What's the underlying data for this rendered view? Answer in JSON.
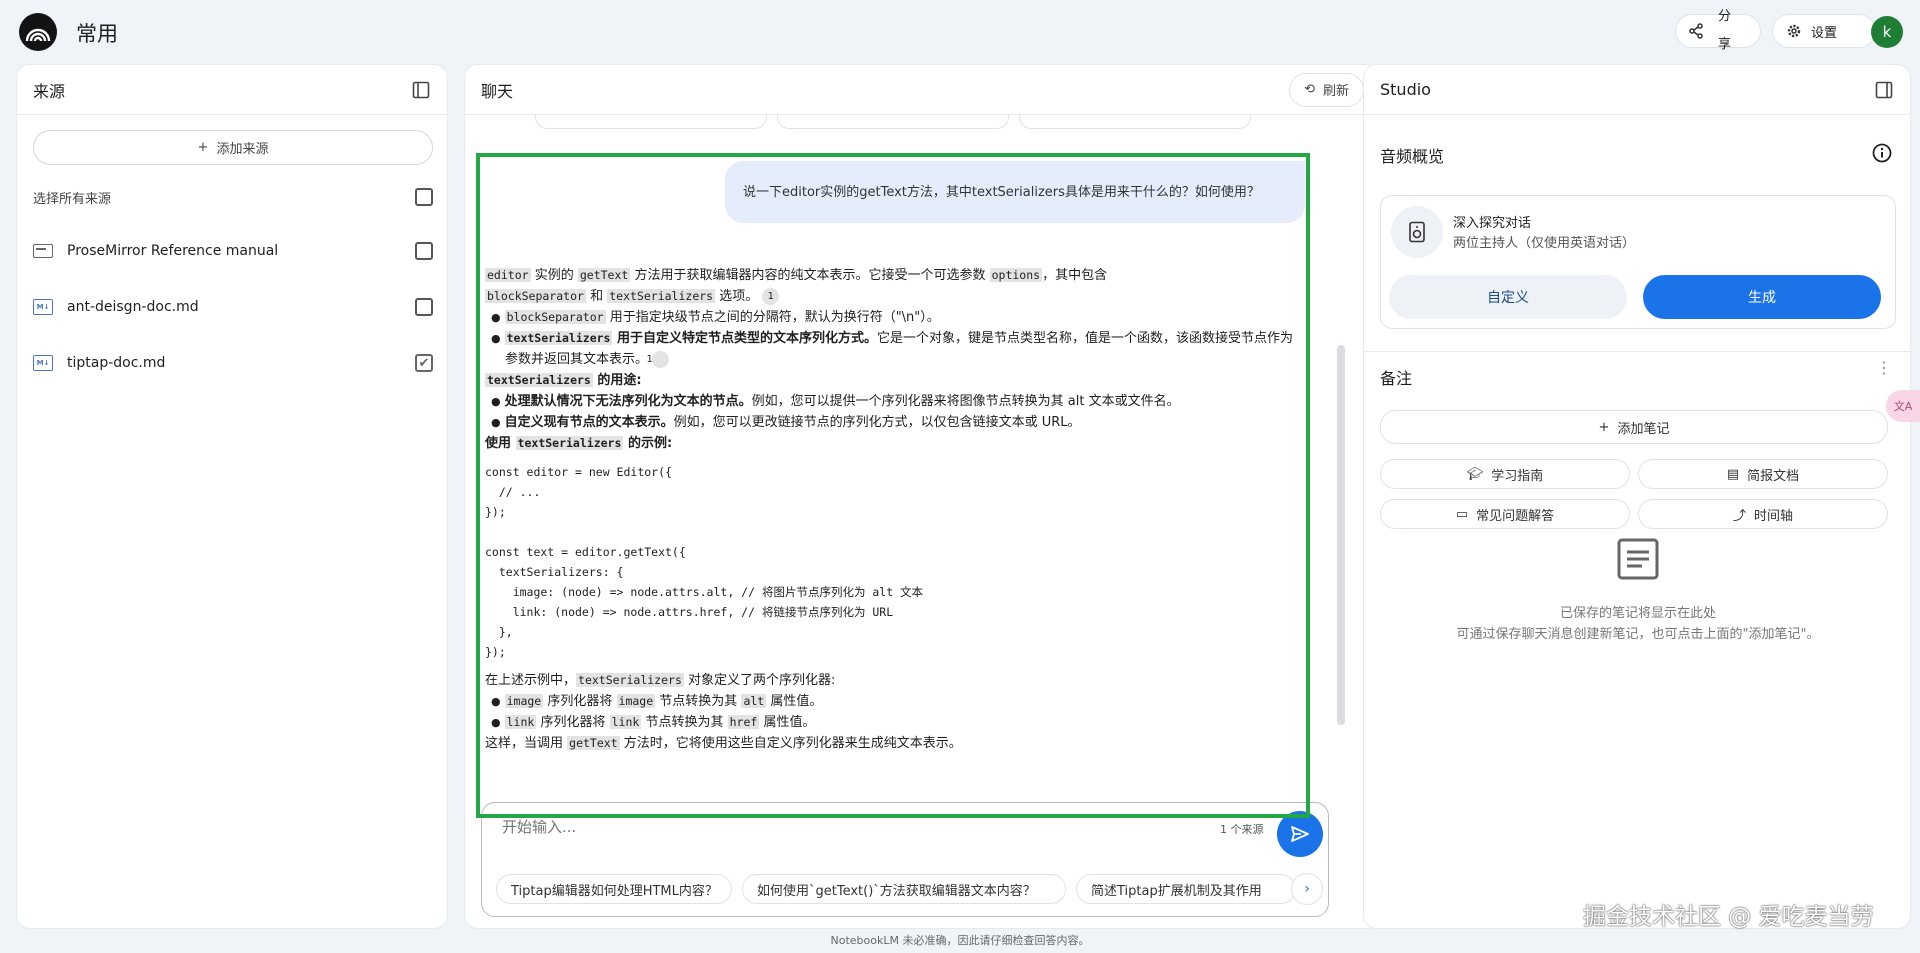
{
  "header": {
    "title": "常用",
    "share_label": "分享",
    "settings_label": "设置",
    "avatar_letter": "k"
  },
  "sources": {
    "title": "来源",
    "add_label": "添加来源",
    "select_all_label": "选择所有来源",
    "items": [
      {
        "name": "ProseMirror Reference manual",
        "icon": "web-doc-icon",
        "checked": false
      },
      {
        "name": "ant-deisgn-doc.md",
        "icon": "markdown-icon",
        "checked": false
      },
      {
        "name": "tiptap-doc.md",
        "icon": "markdown-icon",
        "checked": true
      }
    ]
  },
  "chat": {
    "title": "聊天",
    "refresh_label": "刷新",
    "user_message": "说一下editor实例的getText方法，其中textSerializers具体是用来干什么的？如何使用？",
    "answer": {
      "p1_a": "editor",
      "p1_b": "实例的",
      "p1_c": "getText",
      "p1_d": "方法用于获取编辑器内容的纯文本表示。它接受一个可选参数",
      "p1_e": "options",
      "p1_f": "，其中包含",
      "p1_g": "blockSeparator",
      "p1_h": "和",
      "p1_i": "textSerializers",
      "p1_j": "选项。",
      "cite": "1",
      "b1_code": "blockSeparator",
      "b1_text": "用于指定块级节点之间的分隔符，默认为换行符（\"\\n\"）。",
      "b2_code": "textSerializers",
      "b2_bold": "用于自定义特定节点类型的文本序列化方式。",
      "b2_text": "它是一个对象，键是节点类型名称，值是一个函数，该函数接受节点作为参数并返回其文本表示。",
      "h1_code": "textSerializers",
      "h1_text": "的用途:",
      "b3_bold": "处理默认情况下无法序列化为文本的节点。",
      "b3_text": "例如，您可以提供一个序列化器来将图像节点转换为其 alt 文本或文件名。",
      "b4_bold": "自定义现有节点的文本表示。",
      "b4_text": "例如，您可以更改链接节点的序列化方式，以仅包含链接文本或 URL。",
      "h2_a": "使用",
      "h2_code": "textSerializers",
      "h2_b": "的示例:",
      "code_block": "const editor = new Editor({\n  // ...\n});\n\nconst text = editor.getText({\n  textSerializers: {\n    image: (node) => node.attrs.alt, // 将图片节点序列化为 alt 文本\n    link: (node) => node.attrs.href, // 将链接节点序列化为 URL\n  },\n});",
      "p2_a": "在上述示例中，",
      "p2_code": "textSerializers",
      "p2_b": "对象定义了两个序列化器:",
      "b5_code1": "image",
      "b5_a": "序列化器将",
      "b5_code2": "image",
      "b5_b": "节点转换为其",
      "b5_code3": "alt",
      "b5_c": "属性值。",
      "b6_code1": "link",
      "b6_a": "序列化器将",
      "b6_code2": "link",
      "b6_b": "节点转换为其",
      "b6_code3": "href",
      "b6_c": "属性值。",
      "p3_a": "这样，当调用",
      "p3_code": "getText",
      "p3_b": "方法时，它将使用这些自定义序列化器来生成纯文本表示。"
    },
    "input_placeholder": "开始输入...",
    "source_count": "1 个来源",
    "suggestions": [
      "Tiptap编辑器如何处理HTML内容？",
      "如何使用`getText()`方法获取编辑器文本内容？",
      "简述Tiptap扩展机制及其作用"
    ]
  },
  "studio": {
    "title": "Studio",
    "audio_title": "音频概览",
    "audio_card_title": "深入探究对话",
    "audio_card_sub": "两位主持人（仅使用英语对话）",
    "custom_label": "自定义",
    "generate_label": "生成",
    "notes_title": "备注",
    "add_note_label": "添加笔记",
    "note_buttons": [
      {
        "label": "学习指南",
        "icon": "school-icon"
      },
      {
        "label": "简报文档",
        "icon": "doc-icon"
      },
      {
        "label": "常见问题解答",
        "icon": "faq-icon"
      },
      {
        "label": "时间轴",
        "icon": "timeline-icon"
      }
    ],
    "empty_line1": "已保存的笔记将显示在此处",
    "empty_line2": "可通过保存聊天消息创建新笔记，也可点击上面的\"添加笔记\"。"
  },
  "footer_text": "NotebookLM 未必准确，因此请仔细检查回答内容。",
  "watermark": "掘金技术社区 @ 爱吃麦当劳",
  "translate_tab": "文A",
  "colors": {
    "accent": "#1a73e8",
    "highlight": "#24a845"
  }
}
